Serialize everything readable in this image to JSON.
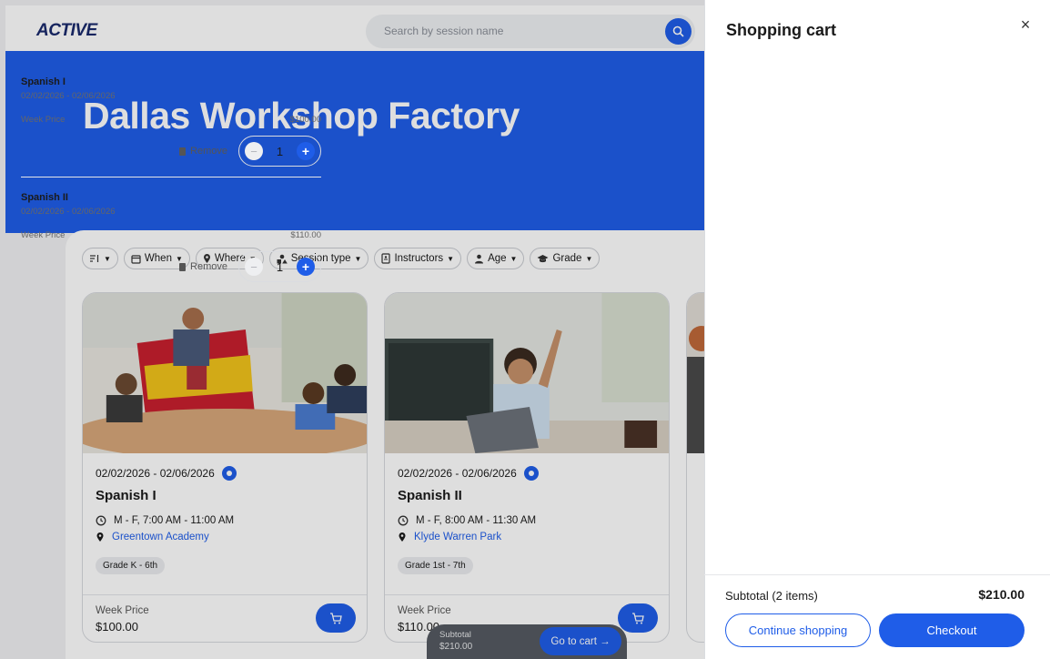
{
  "topbar": {
    "logo": "ACTIVE",
    "search_placeholder": "Search by session name"
  },
  "hero": {
    "title": "Dallas Workshop Factory"
  },
  "filters": [
    {
      "label": "",
      "icon": "sort-icon"
    },
    {
      "label": "When",
      "icon": "calendar-icon"
    },
    {
      "label": "Where",
      "icon": "location-pin-icon"
    },
    {
      "label": "Session type",
      "icon": "shapes-icon"
    },
    {
      "label": "Instructors",
      "icon": "id-card-icon"
    },
    {
      "label": "Age",
      "icon": "person-icon"
    },
    {
      "label": "Grade",
      "icon": "graduation-cap-icon"
    }
  ],
  "cards": [
    {
      "dates": "02/02/2026 - 02/06/2026",
      "title": "Spanish I",
      "time": "M - F, 7:00 AM - 11:00 AM",
      "location": "Greentown Academy",
      "grade": "Grade K - 6th",
      "price_label": "Week Price",
      "price": "$100.00"
    },
    {
      "dates": "02/02/2026 - 02/06/2026",
      "title": "Spanish II",
      "time": "M - F, 8:00 AM - 11:30 AM",
      "location": "Klyde Warren Park",
      "grade": "Grade 1st - 7th",
      "price_label": "Week Price",
      "price": "$110.00"
    }
  ],
  "floatbar": {
    "subtotal_label": "Subtotal",
    "subtotal_value": "$210.00",
    "goto_label": "Go to cart →"
  },
  "cart": {
    "title": "Shopping cart",
    "close": "×",
    "items": [
      {
        "name": "Spanish I",
        "range": "02/02/2026 - 02/06/2026",
        "price_label": "Week Price",
        "price": "$100.00",
        "remove": "Remove",
        "qty": "1"
      },
      {
        "name": "Spanish II",
        "range": "02/02/2026 - 02/06/2026",
        "price_label": "Week Price",
        "price": "$110.00",
        "remove": "Remove",
        "qty": "1"
      }
    ],
    "subtotal_label": "Subtotal (2 items)",
    "subtotal_value": "$210.00",
    "continue_label": "Continue shopping",
    "checkout_label": "Checkout"
  },
  "colors": {
    "accent": "#1f5de8",
    "logo": "#1a2a6c"
  }
}
